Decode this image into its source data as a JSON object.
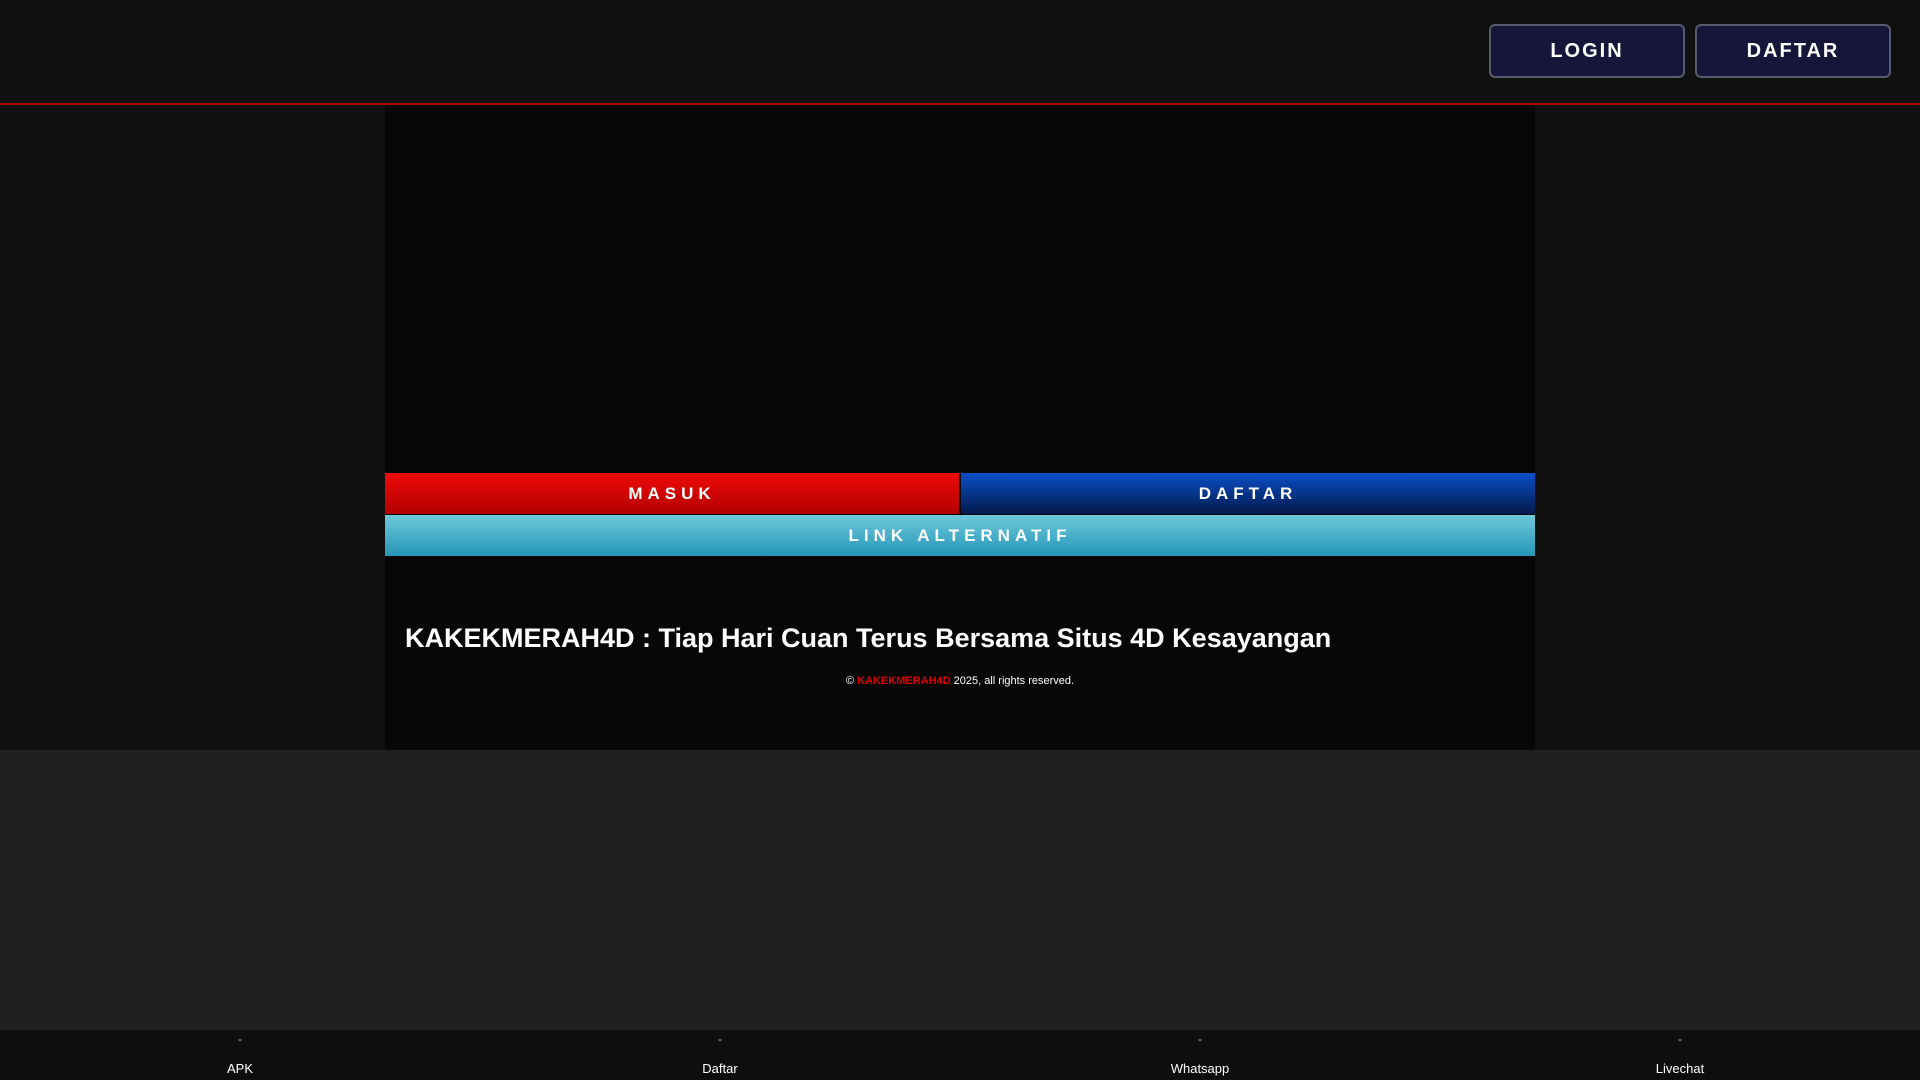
{
  "header": {
    "login_label": "LOGIN",
    "register_label": "DAFTAR"
  },
  "main": {
    "masuk_label": "MASUK",
    "daftar_label": "DAFTAR",
    "alt_link_label": "LINK ALTERNATIF",
    "headline": "KAKEKMERAH4D : Tiap Hari Cuan Terus Bersama Situs 4D Kesayangan"
  },
  "footer": {
    "copyright_symbol": "©",
    "brand": "KAKEKMERAH4D",
    "rights": "2025, all rights reserved."
  },
  "bottom_nav": {
    "items": [
      {
        "label": "APK",
        "icon": "-"
      },
      {
        "label": "Daftar",
        "icon": "-"
      },
      {
        "label": "Whatsapp",
        "icon": "-"
      },
      {
        "label": "Livechat",
        "icon": "-"
      }
    ]
  },
  "colors": {
    "accent_red": "#e00000",
    "accent_blue": "#0a4fc8",
    "accent_cyan": "#2596b8",
    "header_button_bg": "#16163a"
  }
}
